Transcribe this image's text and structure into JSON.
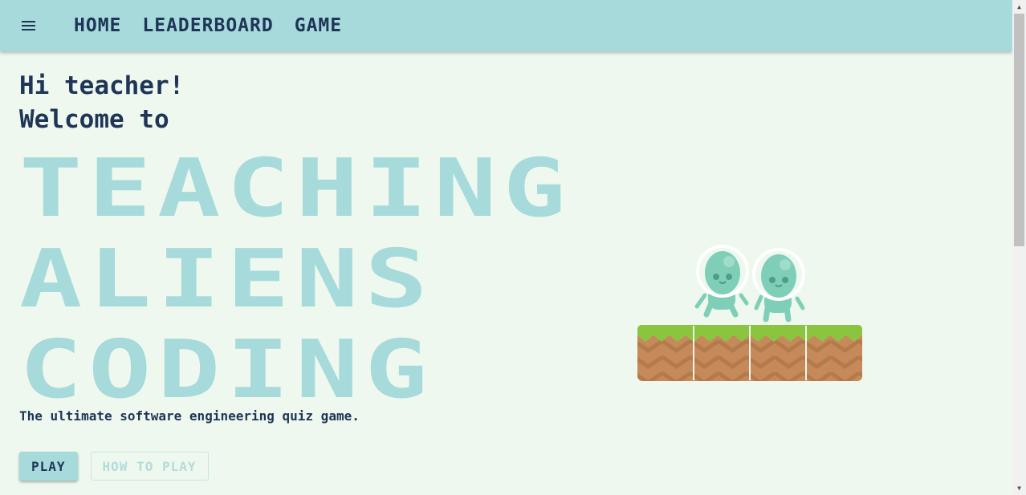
{
  "nav": {
    "links": [
      "HOME",
      "LEADERBOARD",
      "GAME"
    ]
  },
  "hero": {
    "greeting_line1": "Hi teacher!",
    "greeting_line2": "Welcome to",
    "title_line1": "TEACHING",
    "title_line2": "ALIENS",
    "title_line3": "CODING",
    "tagline": "The ultimate software engineering quiz game."
  },
  "buttons": {
    "play": "PLAY",
    "how_to_play": "HOW TO PLAY"
  },
  "icons": {
    "menu": "menu-icon",
    "scroll_up": "scroll-up-icon",
    "scroll_down": "scroll-down-icon"
  },
  "colors": {
    "nav_bg": "#a7dadb",
    "page_bg": "#eef8ee",
    "text_dark": "#1e3557",
    "title_light": "#a7dadb",
    "alien": "#7fcfb8",
    "grass": "#8bc53f",
    "dirt": "#c68a5a"
  }
}
